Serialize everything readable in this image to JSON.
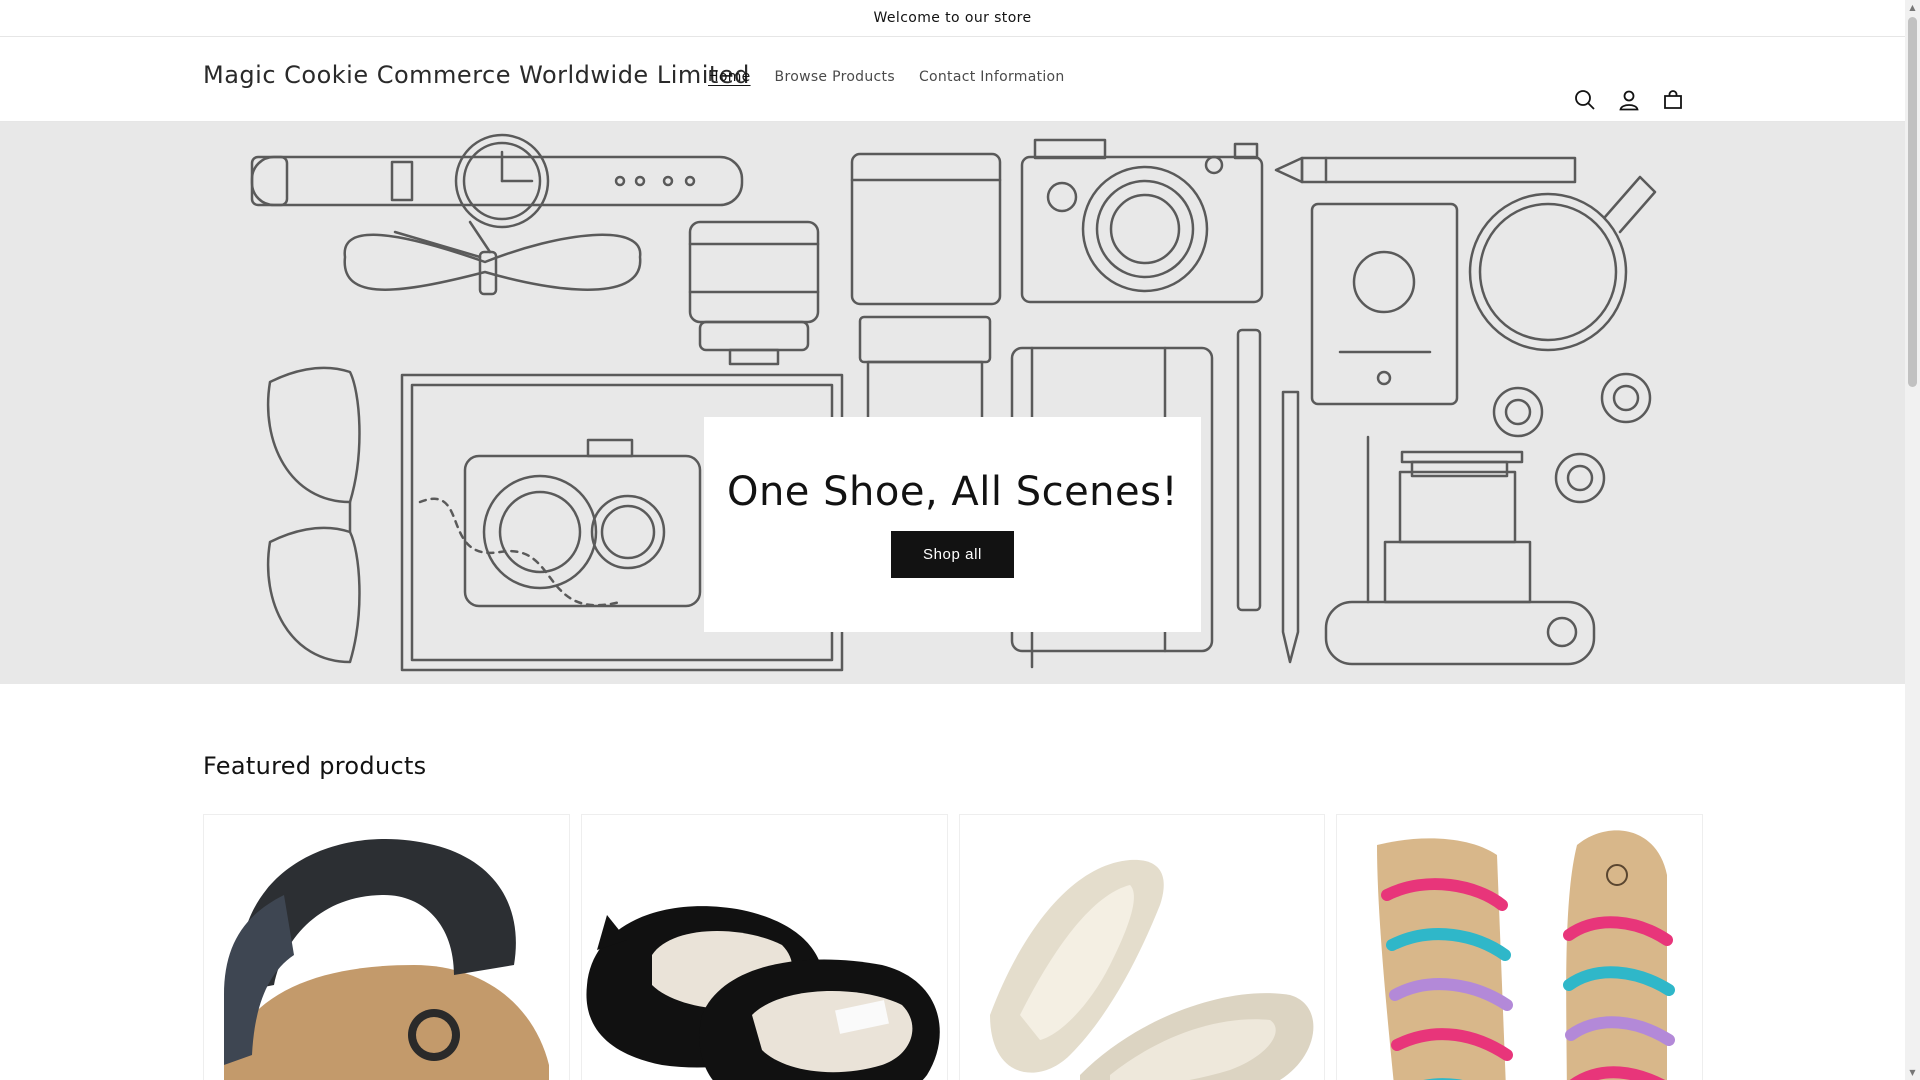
{
  "announcement": {
    "text": "Welcome to our store"
  },
  "header": {
    "logo": "Magic Cookie Commerce Worldwide Limited",
    "nav": [
      {
        "label": "Home",
        "active": true
      },
      {
        "label": "Browse Products",
        "active": false
      },
      {
        "label": "Contact Information",
        "active": false
      }
    ],
    "icons": [
      "search-icon",
      "account-icon",
      "cart-icon"
    ]
  },
  "hero": {
    "title": "One Shoe, All Scenes!",
    "button_label": "Shop all"
  },
  "featured": {
    "title": "Featured products",
    "products": [
      {
        "image": "black-strap-cork-sandal"
      },
      {
        "image": "black-cat-slippers"
      },
      {
        "image": "beige-knit-flats"
      },
      {
        "image": "rainbow-gladiator-sandals"
      }
    ]
  },
  "colors": {
    "accent": "#121212",
    "hero_background": "#e8e8e8",
    "illustration_stroke": "#5a5a5a"
  }
}
